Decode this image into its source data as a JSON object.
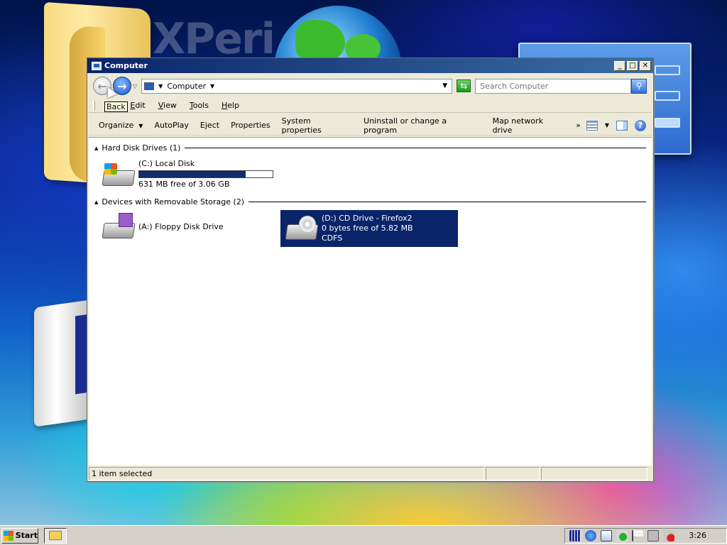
{
  "window": {
    "title": "Computer"
  },
  "address": {
    "location": "Computer",
    "search_placeholder": "Search Computer"
  },
  "menu": [
    "File",
    "Edit",
    "View",
    "Tools",
    "Help"
  ],
  "toolbar": {
    "organize": "Organize",
    "autoplay": "AutoPlay",
    "eject": "Eject",
    "properties": "Properties",
    "system_properties": "System properties",
    "uninstall": "Uninstall or change a program",
    "map_drive": "Map network drive",
    "overflow": "»"
  },
  "groups": {
    "hdd": "Hard Disk Drives (1)",
    "removable": "Devices with Removable Storage (2)"
  },
  "drives": {
    "c": {
      "name": "(C:) Local Disk",
      "free": "631 MB free of 3.06 GB",
      "used_fraction": 0.8
    },
    "a": {
      "name": "(A:) Floppy Disk Drive"
    },
    "d": {
      "name": "(D:) CD Drive - Firefox2",
      "free": "0 bytes free of 5.82 MB",
      "fs": "CDFS"
    }
  },
  "tooltip": "Back",
  "status": {
    "selection": "1 item selected"
  },
  "taskbar": {
    "start": "Start",
    "clock": "3:26"
  },
  "desktop": {
    "wordmark": "XPeri"
  }
}
